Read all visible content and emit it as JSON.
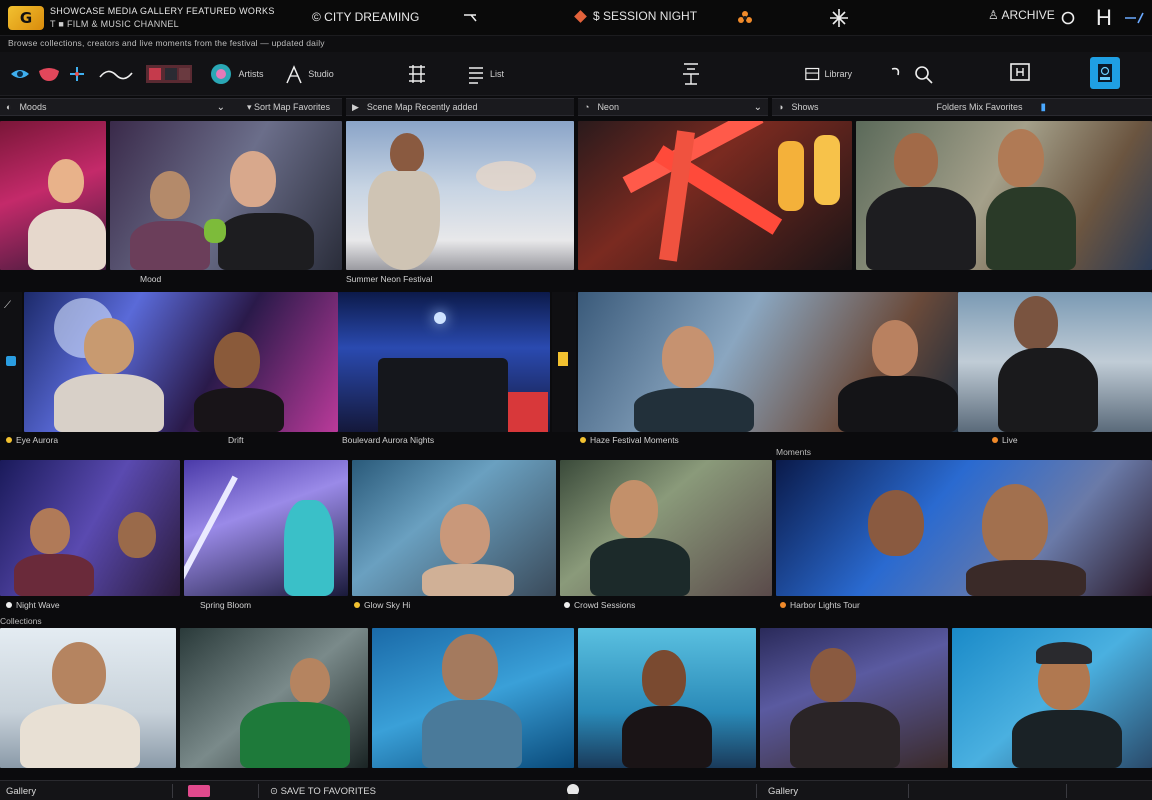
{
  "app": {
    "logo": "G",
    "brand_line1": "SHOWCASE MEDIA GALLERY FEATURED WORKS",
    "brand_line2": "T   ■ FILM & MUSIC CHANNEL"
  },
  "topbar": {
    "title": "© CITY DREAMING",
    "mid_label": "$ SESSION NIGHT",
    "user": "ARCHIVE",
    "icons": [
      "minus-icon",
      "diamond-icon",
      "flower-icon",
      "spark-icon",
      "user-icon",
      "circle-icon",
      "h-icon",
      "arrow-icon"
    ]
  },
  "subrow": {
    "text": "Browse collections, creators and live moments from the festival — updated daily"
  },
  "toolbar": {
    "items": [
      {
        "icon": "globe-icon",
        "label": ""
      },
      {
        "icon": "lips-icon",
        "label": ""
      },
      {
        "icon": "star-icon",
        "label": ""
      },
      {
        "icon": "wave-icon",
        "label": ""
      },
      {
        "icon": "film-icon",
        "label": ""
      },
      {
        "icon": "flower-icon",
        "label": "Artists"
      },
      {
        "icon": "brush-icon",
        "label": "Studio"
      },
      {
        "icon": "grid-icon",
        "label": ""
      },
      {
        "icon": "list-icon",
        "label": "List"
      },
      {
        "icon": "tree-icon",
        "label": ""
      },
      {
        "icon": "library-icon",
        "label": "Library"
      },
      {
        "icon": "search-icon",
        "label": ""
      },
      {
        "icon": "box-icon",
        "label": ""
      },
      {
        "icon": "profile-icon",
        "label": ""
      }
    ]
  },
  "panels": [
    {
      "label": "Moods",
      "extra": "▾   Sort  Map  Favorites"
    },
    {
      "label": "Scene  Map  Recently added",
      "extra": ""
    },
    {
      "label": "Neon",
      "extra": ""
    },
    {
      "label": "Shows",
      "extra": "Folders  Mix  Favorites"
    }
  ],
  "rows": [
    {
      "captions": [
        "Mood",
        "Summer Neon Festival",
        "",
        ""
      ]
    },
    {
      "captions": [
        "Eye  Aurora",
        "Drift",
        "Boulevard  Aurora  Nights",
        "Haze  Festival  Moments",
        "Live"
      ]
    },
    {
      "captions": [
        "Night  Wave",
        "Spring Bloom",
        "Glow  Sky  Hi",
        "Crowd  Sessions",
        "Harbor  Lights  Tour"
      ]
    },
    {
      "captions": [
        "",
        "",
        "",
        "",
        "",
        "",
        ""
      ]
    }
  ],
  "row3_header": {
    "left": "Collections",
    "right": "Moments"
  },
  "bottombar": {
    "left": "Gallery",
    "mid": "⊙  SAVE TO FAVORITES",
    "right": "Gallery"
  }
}
